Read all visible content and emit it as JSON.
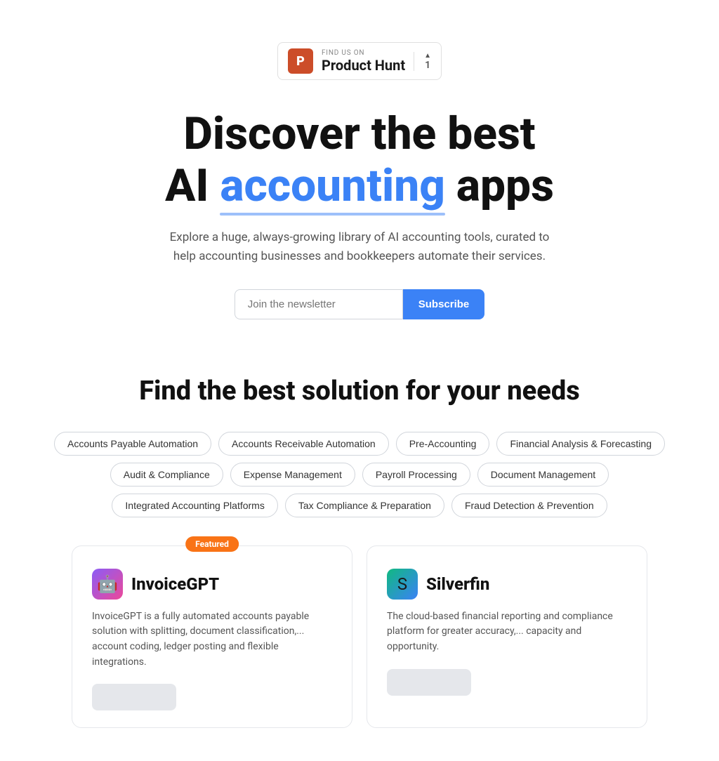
{
  "ph_badge": {
    "find_us": "FIND US ON",
    "name": "Product Hunt",
    "icon_letter": "P",
    "vote_count": "1"
  },
  "hero": {
    "line1": "Discover the best",
    "line2_prefix": "AI ",
    "line2_accent": "accounting",
    "line2_suffix": " apps",
    "subtitle": "Explore a huge, always-growing library of AI accounting tools, curated to help accounting businesses and bookkeepers automate their services."
  },
  "newsletter": {
    "placeholder": "Join the newsletter",
    "subscribe_label": "Subscribe"
  },
  "solutions": {
    "title": "Find the best solution for your needs",
    "tags": [
      "Accounts Payable Automation",
      "Accounts Receivable Automation",
      "Pre-Accounting",
      "Financial Analysis & Forecasting",
      "Audit & Compliance",
      "Expense Management",
      "Payroll Processing",
      "Document Management",
      "Integrated Accounting Platforms",
      "Tax Compliance & Preparation",
      "Fraud Detection & Prevention"
    ]
  },
  "cards": [
    {
      "id": "invoicegpt",
      "featured": true,
      "featured_label": "Featured",
      "name": "InvoiceGPT",
      "icon": "🤖",
      "description": "InvoiceGPT is a fully automated accounts payable solution with splitting, document classification,... account coding, ledger posting and flexible integrations."
    },
    {
      "id": "silverfin",
      "featured": false,
      "featured_label": "",
      "name": "Silverfin",
      "icon": "S",
      "description": "The cloud-based financial reporting and compliance platform for greater accuracy,... capacity and opportunity."
    }
  ]
}
